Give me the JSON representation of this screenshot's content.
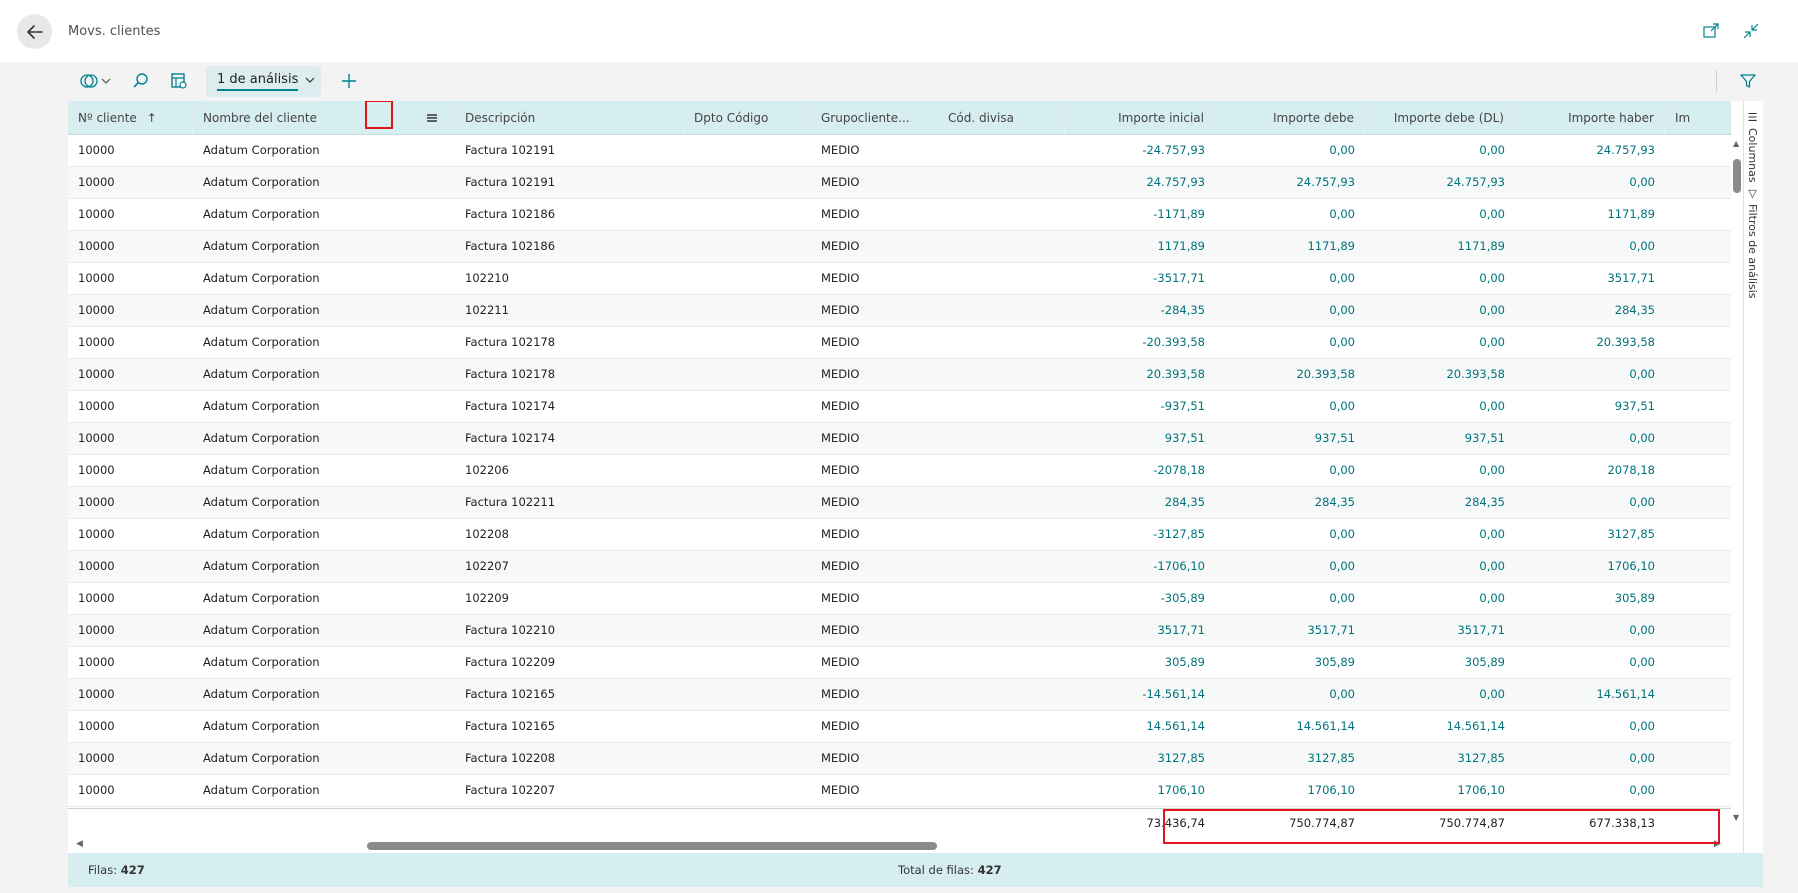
{
  "header": {
    "title": "Movs. clientes"
  },
  "toolbar": {
    "analysis_tab": "1 de análisis"
  },
  "columns": [
    "Nº cliente",
    "Nombre del cliente",
    "Descripción",
    "Dpto Código",
    "Grupocliente...",
    "Cód. divisa",
    "Importe inicial",
    "Importe debe",
    "Importe debe (DL)",
    "Importe haber",
    "Im"
  ],
  "side_tabs": {
    "columns": "Columnas",
    "filters": "Filtros de análisis"
  },
  "rows": [
    {
      "no": "10000",
      "name": "Adatum Corporation",
      "desc": "Factura 102191",
      "group": "MEDIO",
      "inicial": "-24.757,93",
      "debe": "0,00",
      "debe_dl": "0,00",
      "haber": "24.757,93"
    },
    {
      "no": "10000",
      "name": "Adatum Corporation",
      "desc": "Factura 102191",
      "group": "MEDIO",
      "inicial": "24.757,93",
      "debe": "24.757,93",
      "debe_dl": "24.757,93",
      "haber": "0,00"
    },
    {
      "no": "10000",
      "name": "Adatum Corporation",
      "desc": "Factura 102186",
      "group": "MEDIO",
      "inicial": "-1171,89",
      "debe": "0,00",
      "debe_dl": "0,00",
      "haber": "1171,89"
    },
    {
      "no": "10000",
      "name": "Adatum Corporation",
      "desc": "Factura 102186",
      "group": "MEDIO",
      "inicial": "1171,89",
      "debe": "1171,89",
      "debe_dl": "1171,89",
      "haber": "0,00"
    },
    {
      "no": "10000",
      "name": "Adatum Corporation",
      "desc": "102210",
      "group": "MEDIO",
      "inicial": "-3517,71",
      "debe": "0,00",
      "debe_dl": "0,00",
      "haber": "3517,71"
    },
    {
      "no": "10000",
      "name": "Adatum Corporation",
      "desc": "102211",
      "group": "MEDIO",
      "inicial": "-284,35",
      "debe": "0,00",
      "debe_dl": "0,00",
      "haber": "284,35"
    },
    {
      "no": "10000",
      "name": "Adatum Corporation",
      "desc": "Factura 102178",
      "group": "MEDIO",
      "inicial": "-20.393,58",
      "debe": "0,00",
      "debe_dl": "0,00",
      "haber": "20.393,58"
    },
    {
      "no": "10000",
      "name": "Adatum Corporation",
      "desc": "Factura 102178",
      "group": "MEDIO",
      "inicial": "20.393,58",
      "debe": "20.393,58",
      "debe_dl": "20.393,58",
      "haber": "0,00"
    },
    {
      "no": "10000",
      "name": "Adatum Corporation",
      "desc": "Factura 102174",
      "group": "MEDIO",
      "inicial": "-937,51",
      "debe": "0,00",
      "debe_dl": "0,00",
      "haber": "937,51"
    },
    {
      "no": "10000",
      "name": "Adatum Corporation",
      "desc": "Factura 102174",
      "group": "MEDIO",
      "inicial": "937,51",
      "debe": "937,51",
      "debe_dl": "937,51",
      "haber": "0,00"
    },
    {
      "no": "10000",
      "name": "Adatum Corporation",
      "desc": "102206",
      "group": "MEDIO",
      "inicial": "-2078,18",
      "debe": "0,00",
      "debe_dl": "0,00",
      "haber": "2078,18"
    },
    {
      "no": "10000",
      "name": "Adatum Corporation",
      "desc": "Factura 102211",
      "group": "MEDIO",
      "inicial": "284,35",
      "debe": "284,35",
      "debe_dl": "284,35",
      "haber": "0,00"
    },
    {
      "no": "10000",
      "name": "Adatum Corporation",
      "desc": "102208",
      "group": "MEDIO",
      "inicial": "-3127,85",
      "debe": "0,00",
      "debe_dl": "0,00",
      "haber": "3127,85"
    },
    {
      "no": "10000",
      "name": "Adatum Corporation",
      "desc": "102207",
      "group": "MEDIO",
      "inicial": "-1706,10",
      "debe": "0,00",
      "debe_dl": "0,00",
      "haber": "1706,10"
    },
    {
      "no": "10000",
      "name": "Adatum Corporation",
      "desc": "102209",
      "group": "MEDIO",
      "inicial": "-305,89",
      "debe": "0,00",
      "debe_dl": "0,00",
      "haber": "305,89"
    },
    {
      "no": "10000",
      "name": "Adatum Corporation",
      "desc": "Factura 102210",
      "group": "MEDIO",
      "inicial": "3517,71",
      "debe": "3517,71",
      "debe_dl": "3517,71",
      "haber": "0,00"
    },
    {
      "no": "10000",
      "name": "Adatum Corporation",
      "desc": "Factura 102209",
      "group": "MEDIO",
      "inicial": "305,89",
      "debe": "305,89",
      "debe_dl": "305,89",
      "haber": "0,00"
    },
    {
      "no": "10000",
      "name": "Adatum Corporation",
      "desc": "Factura 102165",
      "group": "MEDIO",
      "inicial": "-14.561,14",
      "debe": "0,00",
      "debe_dl": "0,00",
      "haber": "14.561,14"
    },
    {
      "no": "10000",
      "name": "Adatum Corporation",
      "desc": "Factura 102165",
      "group": "MEDIO",
      "inicial": "14.561,14",
      "debe": "14.561,14",
      "debe_dl": "14.561,14",
      "haber": "0,00"
    },
    {
      "no": "10000",
      "name": "Adatum Corporation",
      "desc": "Factura 102208",
      "group": "MEDIO",
      "inicial": "3127,85",
      "debe": "3127,85",
      "debe_dl": "3127,85",
      "haber": "0,00"
    },
    {
      "no": "10000",
      "name": "Adatum Corporation",
      "desc": "Factura 102207",
      "group": "MEDIO",
      "inicial": "1706,10",
      "debe": "1706,10",
      "debe_dl": "1706,10",
      "haber": "0,00"
    }
  ],
  "totals": {
    "inicial": "73.436,74",
    "debe": "750.774,87",
    "debe_dl": "750.774,87",
    "haber": "677.338,13"
  },
  "status": {
    "rows_label": "Filas:",
    "rows_value": "427",
    "total_label": "Total de filas:",
    "total_value": "427"
  },
  "colors": {
    "accent": "#00838f",
    "header_bg": "#d7eef1",
    "highlight": "#e0161e",
    "number_text": "#00727c"
  },
  "icons": [
    "back-arrow-icon",
    "open-in-new-window-icon",
    "collapse-icon",
    "analysis-mode-icon",
    "search-icon",
    "edit-list-icon",
    "plus-icon",
    "filter-icon",
    "column-menu-icon",
    "sort-ascending-icon"
  ]
}
